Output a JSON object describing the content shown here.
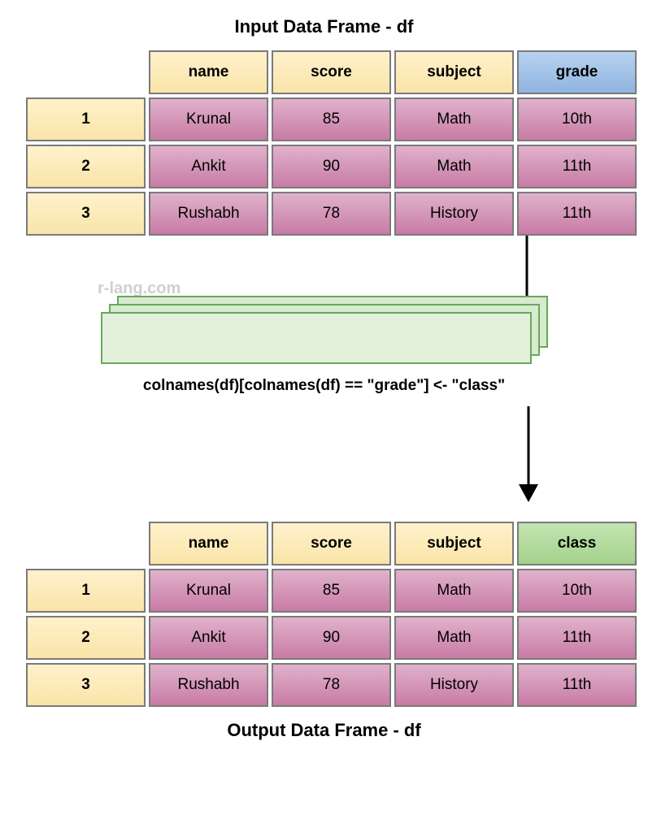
{
  "titles": {
    "input": "Input Data Frame - df",
    "output": "Output Data Frame - df"
  },
  "watermark": "r-lang.com",
  "code": "colnames(df)[colnames(df) == \"grade\"] <- \"class\"",
  "input_table": {
    "headers": [
      "name",
      "score",
      "subject",
      "grade"
    ],
    "highlight_header_index": 3,
    "highlight_style": "blue",
    "row_indices": [
      "1",
      "2",
      "3"
    ],
    "rows": [
      [
        "Krunal",
        "85",
        "Math",
        "10th"
      ],
      [
        "Ankit",
        "90",
        "Math",
        "11th"
      ],
      [
        "Rushabh",
        "78",
        "History",
        "11th"
      ]
    ]
  },
  "output_table": {
    "headers": [
      "name",
      "score",
      "subject",
      "class"
    ],
    "highlight_header_index": 3,
    "highlight_style": "green",
    "row_indices": [
      "1",
      "2",
      "3"
    ],
    "rows": [
      [
        "Krunal",
        "85",
        "Math",
        "10th"
      ],
      [
        "Ankit",
        "90",
        "Math",
        "11th"
      ],
      [
        "Rushabh",
        "78",
        "History",
        "11th"
      ]
    ]
  },
  "chart_data": {
    "type": "table",
    "description": "Diagram showing renaming a column in an R data frame using colnames()",
    "input": {
      "columns": [
        "name",
        "score",
        "subject",
        "grade"
      ],
      "data": [
        {
          "name": "Krunal",
          "score": 85,
          "subject": "Math",
          "grade": "10th"
        },
        {
          "name": "Ankit",
          "score": 90,
          "subject": "Math",
          "grade": "11th"
        },
        {
          "name": "Rushabh",
          "score": 78,
          "subject": "History",
          "grade": "11th"
        }
      ]
    },
    "operation": "colnames(df)[colnames(df) == \"grade\"] <- \"class\"",
    "output": {
      "columns": [
        "name",
        "score",
        "subject",
        "class"
      ],
      "data": [
        {
          "name": "Krunal",
          "score": 85,
          "subject": "Math",
          "class": "10th"
        },
        {
          "name": "Ankit",
          "score": 90,
          "subject": "Math",
          "class": "11th"
        },
        {
          "name": "Rushabh",
          "score": 78,
          "subject": "History",
          "class": "11th"
        }
      ]
    }
  }
}
